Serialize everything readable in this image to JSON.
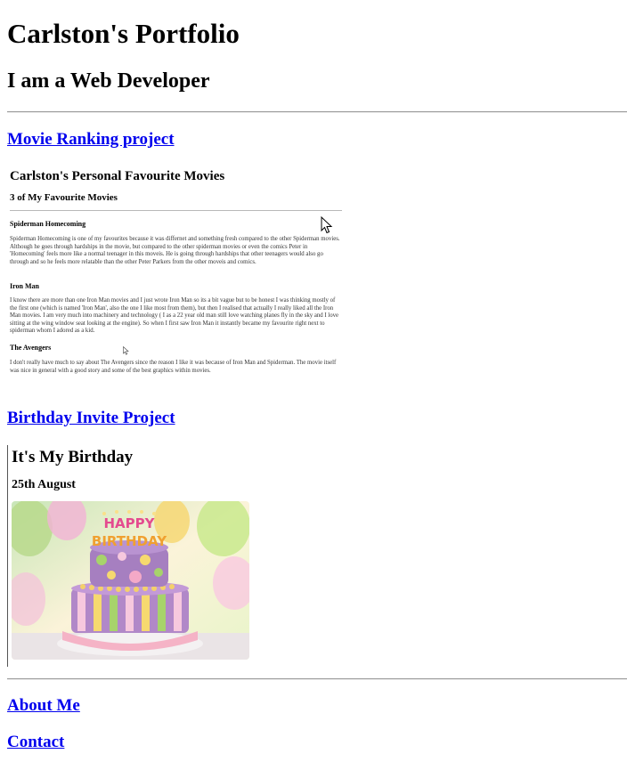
{
  "header": {
    "title": "Carlston's Portfolio",
    "subtitle": "I am a Web Developer"
  },
  "projects": {
    "movie": {
      "link_label": "Movie Ranking project",
      "preview": {
        "title": "Carlston's Personal Favourite Movies",
        "subtitle": "3 of My Favourite Movies",
        "movies": [
          {
            "name": "Spiderman Homecoming",
            "text": "Spiderman Homecoming is one of my favourites because it was differnet and something fresh compared to the other Spiderman movies. Although he goes through hardships in the movie, but compared to the other spiderman movies or even the comics Peter in 'Homecoming' feels more like a normal teenager in this moveis. He is going through hardships that other teenagers would also go through and so he feels more relatable than the other Peter Parkers from the other moveis and comics."
          },
          {
            "name": "Iron Man",
            "text": "I know there are more than one Iron Man movies and I just wrote Iron Man so its a bit vague but to be honest I was thinking mostly of the first one (which is named 'Iron Man', also the one I like most from them), but then I realised that actually I really liked all the Iron Man movies. I am very much into machinery and technology ( I as a 22 year old man still love watching planes fly in the sky and I love sitting at the wing window seat looking at the engine). So when I first saw Iron Man it instantly became my favourite right next to spiderman whom I adored as a kid."
          },
          {
            "name": "The Avengers",
            "text": "I don't really have much to say about The Avengers since the reason I like it was because of Iron Man and Spiderman. The movie itself was nice in general with a good story and some of the best graphics within movies."
          }
        ]
      }
    },
    "birthday": {
      "link_label": "Birthday Invite Project",
      "preview": {
        "heading": "It's My Birthday",
        "date": "25th August",
        "image_icon": "birthday-cake-image",
        "banner": "HAPPY BIRTHDAY"
      }
    }
  },
  "footer_links": {
    "about": "About Me",
    "contact": "Contact"
  },
  "colors": {
    "link": "#0000ee",
    "rule": "#9a9a9a"
  }
}
